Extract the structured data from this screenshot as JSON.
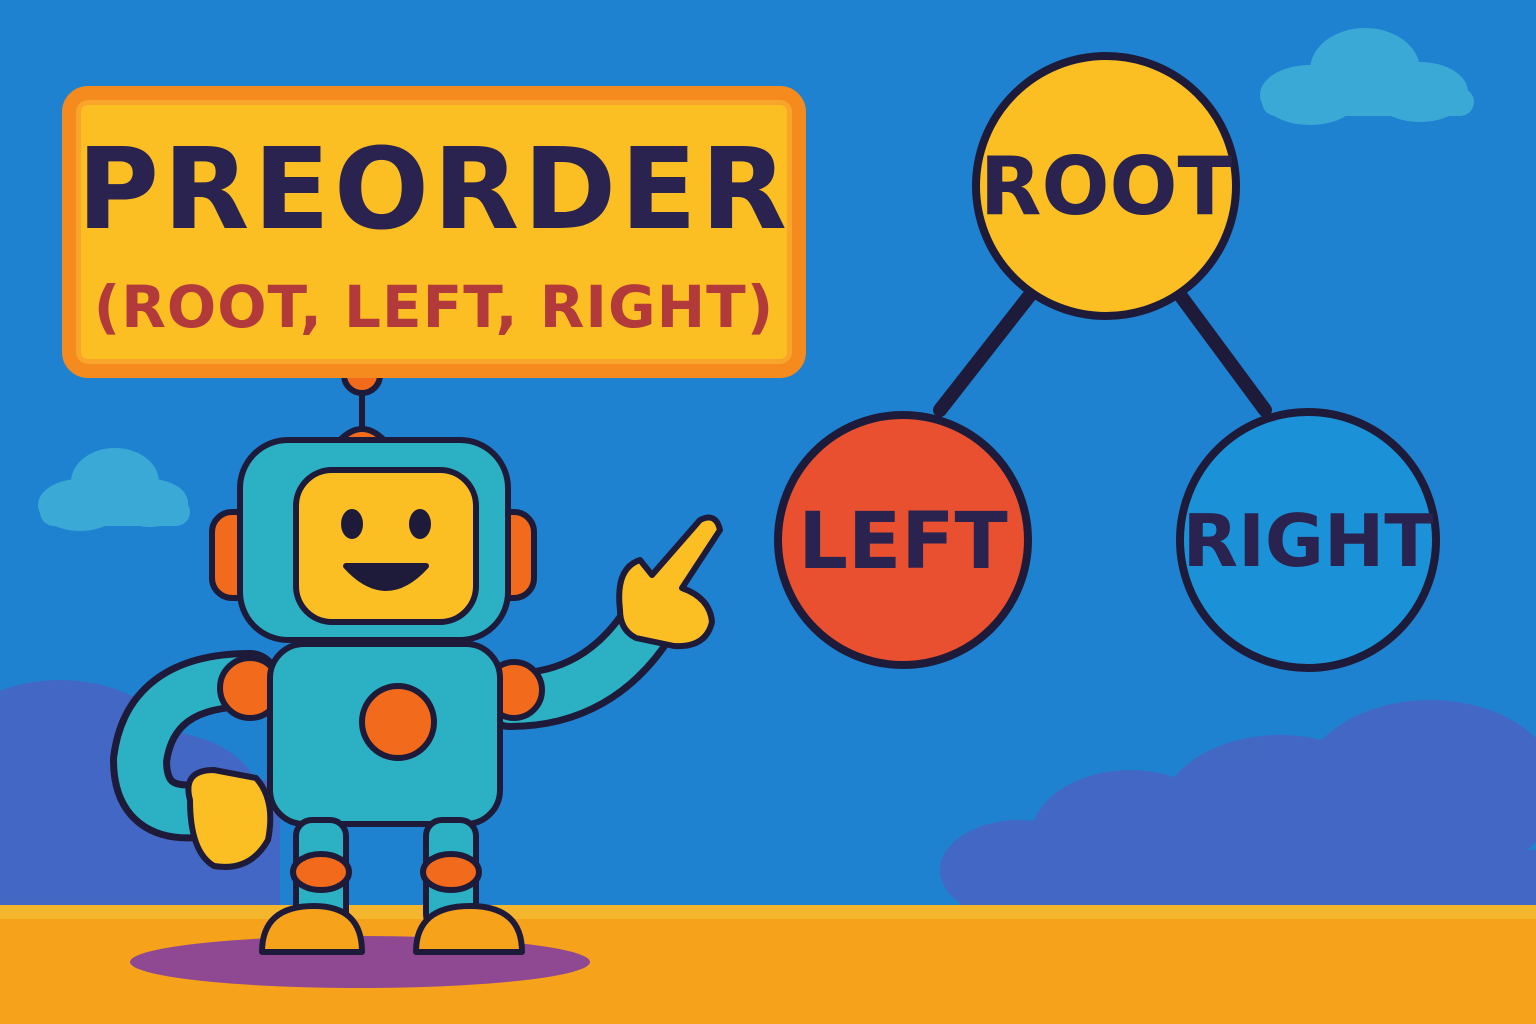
{
  "title": {
    "main": "PREORDER",
    "subtitle": "(ROOT, LEFT, RIGHT)"
  },
  "tree": {
    "nodes": [
      {
        "id": "root",
        "label": "ROOT",
        "color": "#fbbf24"
      },
      {
        "id": "left",
        "label": "LEFT",
        "color": "#e8502f"
      },
      {
        "id": "right",
        "label": "RIGHT",
        "color": "#1b92d8"
      }
    ],
    "edges": [
      {
        "from": "root",
        "to": "left"
      },
      {
        "from": "root",
        "to": "right"
      }
    ]
  },
  "colors": {
    "sky": "#1f82d0",
    "ground": "#f7a21b",
    "outline": "#2a2350",
    "robot_body": "#2cb1c4",
    "robot_accent": "#f26a1b"
  }
}
